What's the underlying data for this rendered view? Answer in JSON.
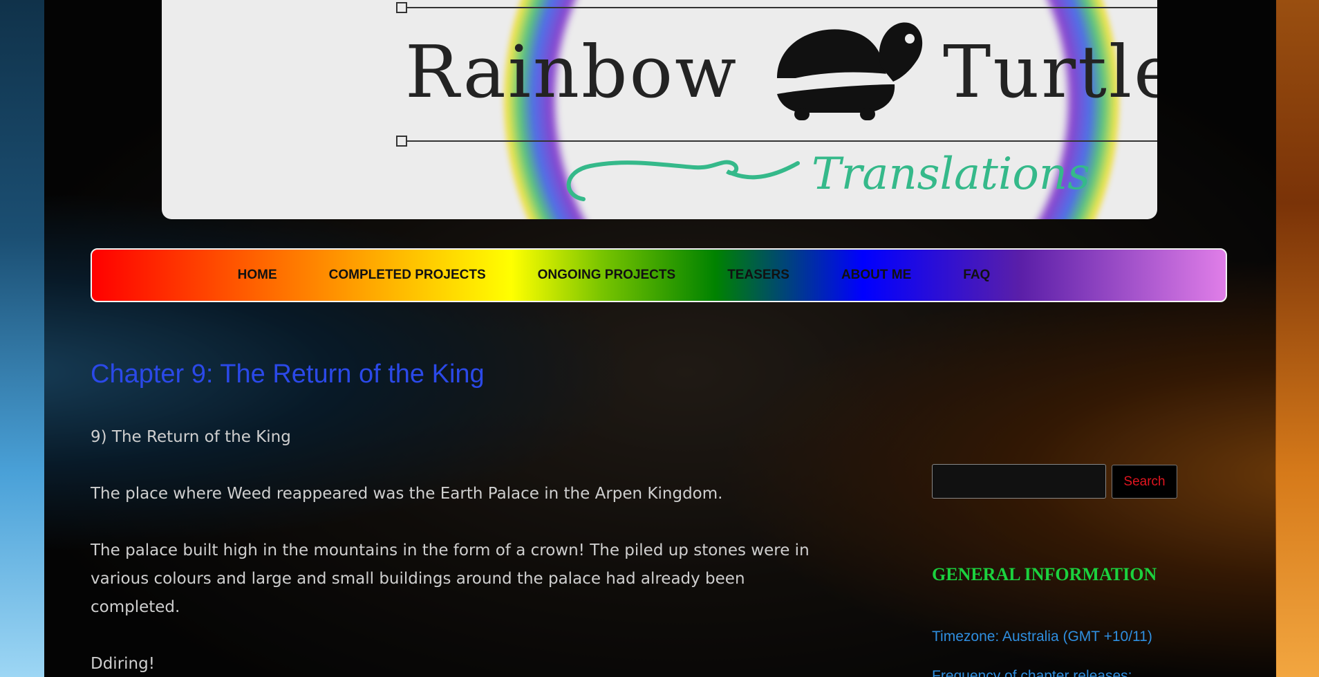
{
  "header": {
    "logo_title_left": "Rainbow",
    "logo_title_right": "Turtle",
    "logo_subtitle": "Translations"
  },
  "nav": {
    "items": [
      {
        "label": "HOME"
      },
      {
        "label": "COMPLETED PROJECTS"
      },
      {
        "label": "ONGOING PROJECTS"
      },
      {
        "label": "TEASERS"
      },
      {
        "label": "ABOUT ME"
      },
      {
        "label": "FAQ"
      }
    ]
  },
  "post": {
    "title": "Chapter 9: The Return of the King",
    "paragraphs": [
      "9) The Return of the King",
      "The place where Weed reappeared was the Earth Palace in the Arpen Kingdom.",
      "The palace built high in the mountains in the form of a crown! The piled up stones were in various colours and large and small buildings around the palace had already been completed.",
      "Ddiring!"
    ]
  },
  "sidebar": {
    "search_button": "Search",
    "search_value": "",
    "widget_title": "GENERAL INFORMATION",
    "timezone": "Timezone: Australia (GMT +10/11)",
    "partial_line": "Frequency of chapter releases: ..."
  },
  "colors": {
    "title_blue": "#2b49e8",
    "widget_green": "#1bd13e",
    "link_blue": "#2f8fe0",
    "search_red": "#e0151f"
  }
}
